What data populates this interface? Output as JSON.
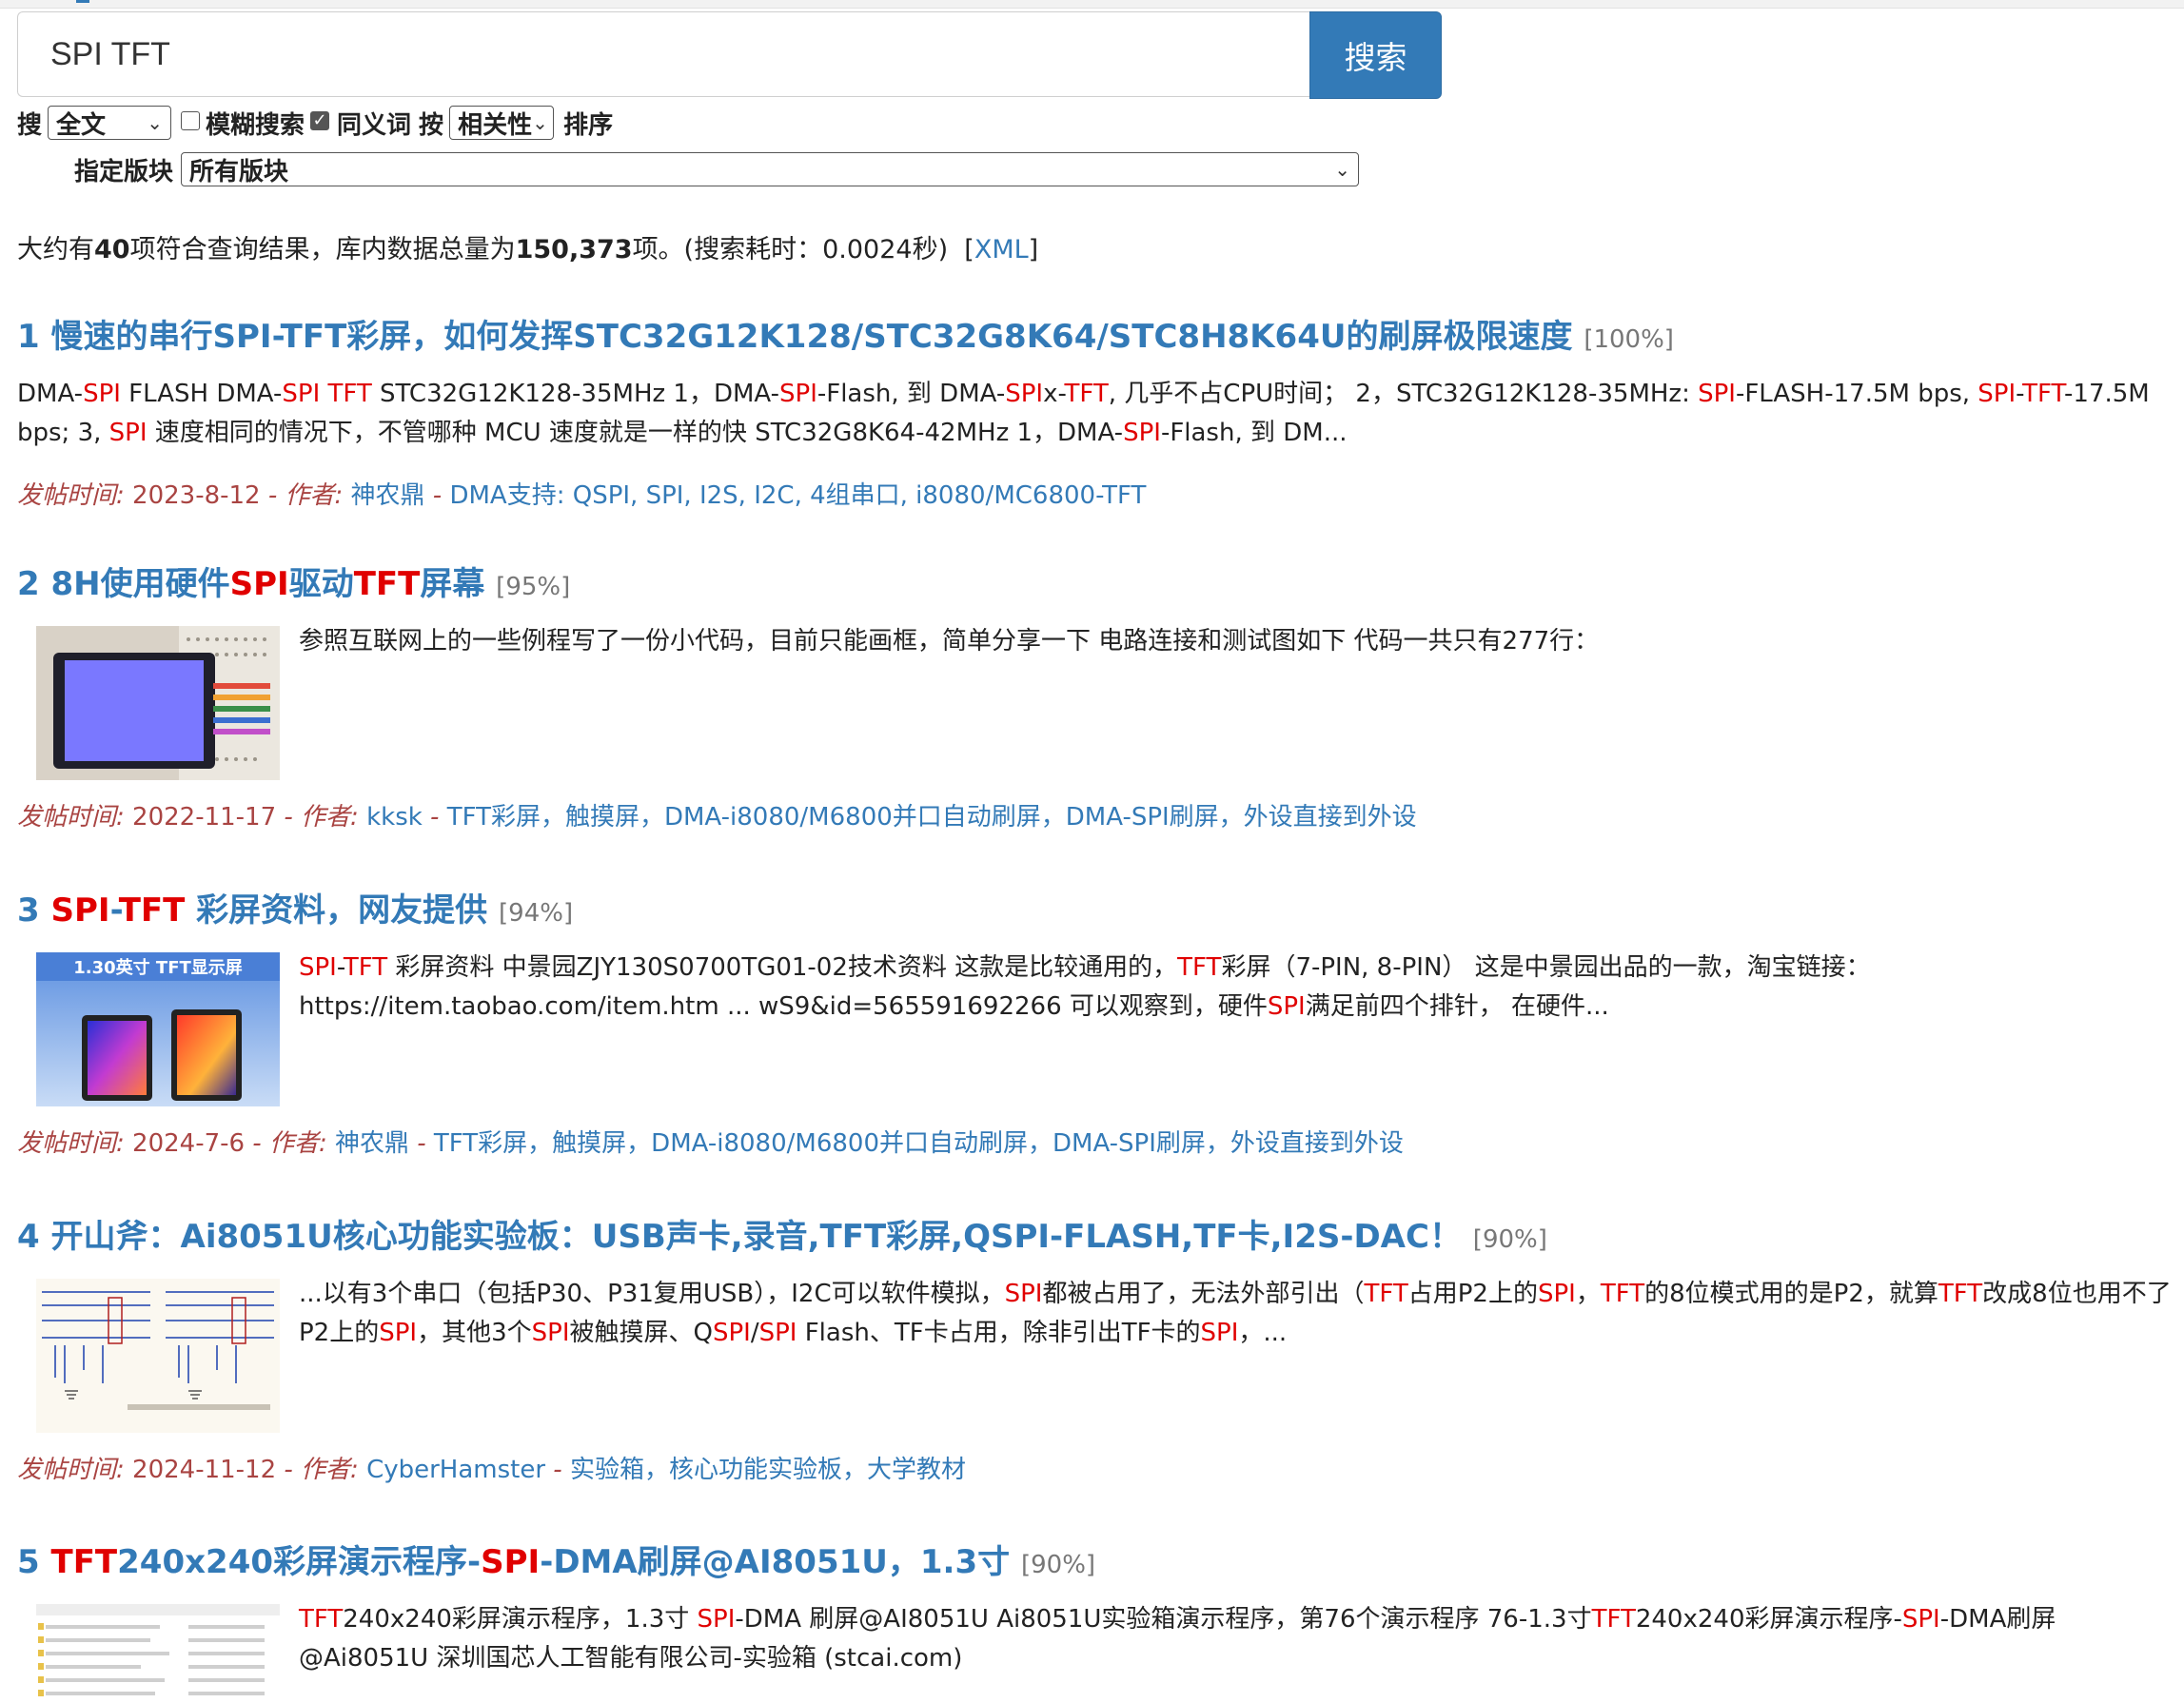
{
  "search": {
    "query": "SPI TFT",
    "button_label": "搜索"
  },
  "options": {
    "search_label": "搜",
    "scope_value": "全文",
    "fuzzy_label": "模糊搜索",
    "fuzzy_checked": false,
    "synonym_label": "同义词",
    "synonym_checked": true,
    "by_label": "按",
    "sort_value": "相关性",
    "sort_label": "排序",
    "board_label": "指定版块",
    "board_value": "所有版块"
  },
  "summary": {
    "prefix": "大约有",
    "count": "40",
    "middle": "项符合查询结果，库内数据总量为",
    "total": "150,373",
    "suffix": "项。(搜索耗时：0.0024秒)",
    "xml_open": "[",
    "xml_link": "XML",
    "xml_close": "]"
  },
  "meta_labels": {
    "time": "发帖时间: ",
    "author": " - 作者: ",
    "sep": " - "
  },
  "results": [
    {
      "number": "1",
      "title_parts": [
        {
          "t": "慢速的串行SPI-TFT彩屏，如何发挥STC32G12K128/STC32G8K64/STC8H8K64U的刷屏极限速度",
          "h": false
        }
      ],
      "score": "[100%]",
      "body_parts": [
        {
          "t": "DMA-",
          "h": false
        },
        {
          "t": "SPI",
          "h": true
        },
        {
          "t": " FLASH DMA-",
          "h": false
        },
        {
          "t": "SPI",
          "h": true
        },
        {
          "t": " ",
          "h": false
        },
        {
          "t": "TFT",
          "h": true
        },
        {
          "t": " STC32G12K128-35MHz 1，DMA-",
          "h": false
        },
        {
          "t": "SPI",
          "h": true
        },
        {
          "t": "-Flash, 到 DMA-",
          "h": false
        },
        {
          "t": "SPI",
          "h": true
        },
        {
          "t": "x-",
          "h": false
        },
        {
          "t": "TFT",
          "h": true
        },
        {
          "t": ", 几乎不占CPU时间； 2，STC32G12K128-35MHz: ",
          "h": false
        },
        {
          "t": "SPI",
          "h": true
        },
        {
          "t": "-FLASH-17.5M bps, ",
          "h": false
        },
        {
          "t": "SPI",
          "h": true
        },
        {
          "t": "-",
          "h": false
        },
        {
          "t": "TFT",
          "h": true
        },
        {
          "t": "-17.5M bps; 3, ",
          "h": false
        },
        {
          "t": "SPI",
          "h": true
        },
        {
          "t": " 速度相同的情况下，不管哪种 MCU 速度就是一样的快 STC32G8K64-42MHz 1，DMA-",
          "h": false
        },
        {
          "t": "SPI",
          "h": true
        },
        {
          "t": "-Flash, 到 DM...",
          "h": false
        }
      ],
      "date": "2023-8-12",
      "author": "神农鼎",
      "board": "DMA支持: QSPI, SPI, I2S, I2C, 4组串口, i8080/MC6800-TFT"
    },
    {
      "number": "2",
      "title_parts": [
        {
          "t": "8H使用硬件",
          "h": false
        },
        {
          "t": "SPI",
          "h": true
        },
        {
          "t": "驱动",
          "h": false
        },
        {
          "t": "TFT",
          "h": true
        },
        {
          "t": "屏幕",
          "h": false
        }
      ],
      "score": "[95%]",
      "body_parts": [
        {
          "t": "参照互联网上的一些例程写了一份小代码，目前只能画框，简单分享一下 电路连接和测试图如下 代码一共只有277行：",
          "h": false
        }
      ],
      "date": "2022-11-17",
      "author": "kksk",
      "board": "TFT彩屏，触摸屏，DMA-i8080/M6800并口自动刷屏，DMA-SPI刷屏，外设直接到外设"
    },
    {
      "number": "3",
      "title_parts": [
        {
          "t": "SPI",
          "h": true
        },
        {
          "t": "-",
          "h": false
        },
        {
          "t": "TFT",
          "h": true
        },
        {
          "t": " 彩屏资料，网友提供",
          "h": false
        }
      ],
      "score": "[94%]",
      "thumb_caption": "1.30英寸 TFT显示屏",
      "body_parts": [
        {
          "t": "SPI",
          "h": true
        },
        {
          "t": "-",
          "h": false
        },
        {
          "t": "TFT",
          "h": true
        },
        {
          "t": " 彩屏资料 中景园ZJY130S0700TG01-02技术资料 这款是比较通用的，",
          "h": false
        },
        {
          "t": "TFT",
          "h": true
        },
        {
          "t": "彩屏（7-PIN, 8-PIN） 这是中景园出品的一款，淘宝链接： https://item.taobao.com/item.htm ... wS9&id=565591692266 可以观察到，硬件",
          "h": false
        },
        {
          "t": "SPI",
          "h": true
        },
        {
          "t": "满足前四个排针， 在硬件...",
          "h": false
        }
      ],
      "date": "2024-7-6",
      "author": "神农鼎",
      "board": "TFT彩屏，触摸屏，DMA-i8080/M6800并口自动刷屏，DMA-SPI刷屏，外设直接到外设"
    },
    {
      "number": "4",
      "title_parts": [
        {
          "t": "开山斧：Ai8051U核心功能实验板：USB声卡,录音,TFT彩屏,QSPI-FLASH,TF卡,I2S-DAC！",
          "h": false
        }
      ],
      "score": "[90%]",
      "body_parts": [
        {
          "t": "...以有3个串口（包括P30、P31复用USB），I2C可以软件模拟，",
          "h": false
        },
        {
          "t": "SPI",
          "h": true
        },
        {
          "t": "都被占用了，无法外部引出（",
          "h": false
        },
        {
          "t": "TFT",
          "h": true
        },
        {
          "t": "占用P2上的",
          "h": false
        },
        {
          "t": "SPI",
          "h": true
        },
        {
          "t": "，",
          "h": false
        },
        {
          "t": "TFT",
          "h": true
        },
        {
          "t": "的8位模式用的是P2，就算",
          "h": false
        },
        {
          "t": "TFT",
          "h": true
        },
        {
          "t": "改成8位也用不了P2上的",
          "h": false
        },
        {
          "t": "SPI",
          "h": true
        },
        {
          "t": "，其他3个",
          "h": false
        },
        {
          "t": "SPI",
          "h": true
        },
        {
          "t": "被触摸屏、Q",
          "h": false
        },
        {
          "t": "SPI",
          "h": true
        },
        {
          "t": "/",
          "h": false
        },
        {
          "t": "SPI",
          "h": true
        },
        {
          "t": " Flash、TF卡占用，除非引出TF卡的",
          "h": false
        },
        {
          "t": "SPI",
          "h": true
        },
        {
          "t": "，...",
          "h": false
        }
      ],
      "date": "2024-11-12",
      "author": "CyberHamster",
      "board": "实验箱，核心功能实验板，大学教材"
    },
    {
      "number": "5",
      "title_parts": [
        {
          "t": "TFT",
          "h": true
        },
        {
          "t": "240x240彩屏演示程序-",
          "h": false
        },
        {
          "t": "SPI",
          "h": true
        },
        {
          "t": "-DMA刷屏@AI8051U，1.3寸",
          "h": false
        }
      ],
      "score": "[90%]",
      "body_parts": [
        {
          "t": "TFT",
          "h": true
        },
        {
          "t": "240x240彩屏演示程序，1.3寸 ",
          "h": false
        },
        {
          "t": "SPI",
          "h": true
        },
        {
          "t": "-DMA 刷屏@AI8051U Ai8051U实验箱演示程序，第76个演示程序 76-1.3寸",
          "h": false
        },
        {
          "t": "TFT",
          "h": true
        },
        {
          "t": "240x240彩屏演示程序-",
          "h": false
        },
        {
          "t": "SPI",
          "h": true
        },
        {
          "t": "-DMA刷屏@Ai8051U 深圳国芯人工智能有限公司-实验箱 (stcai.com)",
          "h": false
        }
      ]
    }
  ],
  "colors": {
    "accent": "#337ab7",
    "highlight": "#e00000",
    "meta_label": "#a94442"
  }
}
